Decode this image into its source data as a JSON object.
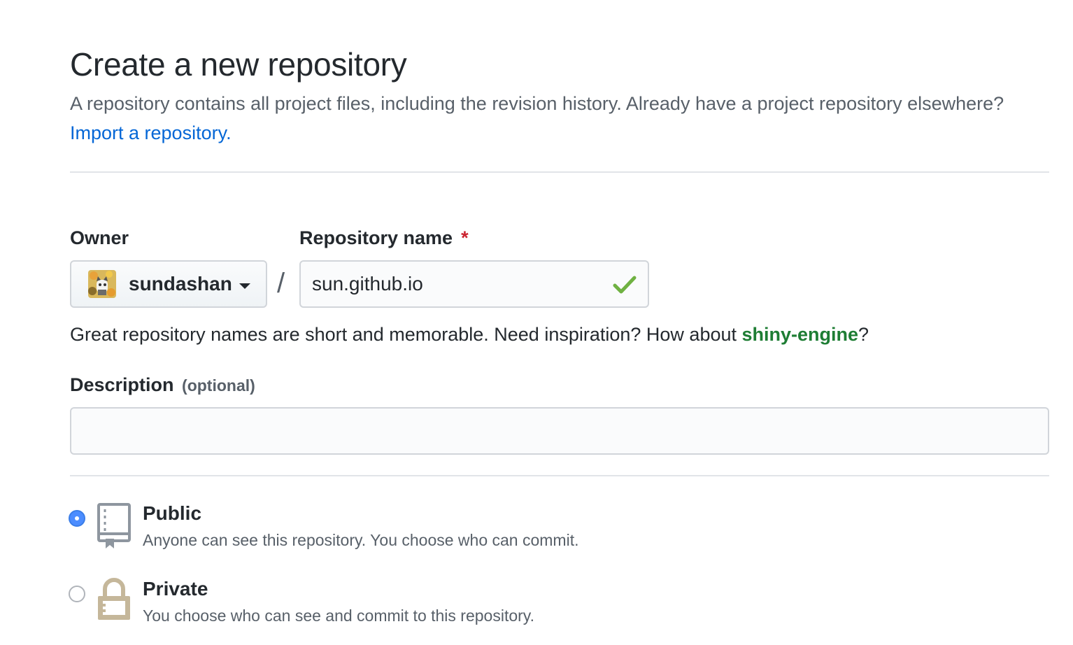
{
  "header": {
    "title": "Create a new repository",
    "subtitle_text": "A repository contains all project files, including the revision history. Already have a project repository elsewhere?",
    "import_link": "Import a repository."
  },
  "form": {
    "owner_label": "Owner",
    "owner_value": "sundashan",
    "repo_label": "Repository name",
    "required_mark": "*",
    "slash": "/",
    "repo_value": "sun.github.io",
    "hint_prefix": "Great repository names are short and memorable. Need inspiration? How about",
    "hint_suggestion": "shiny-engine",
    "hint_suffix": "?",
    "description_label": "Description",
    "description_optional": "(optional)",
    "description_value": ""
  },
  "visibility": {
    "public_title": "Public",
    "public_desc": "Anyone can see this repository. You choose who can commit.",
    "private_title": "Private",
    "private_desc": "You choose who can see and commit to this repository.",
    "selected": "Public"
  },
  "colors": {
    "link": "#0366d6",
    "suggestion": "#1e7e34",
    "required": "#cb2431",
    "valid_check": "#6fb142",
    "radio_selected": "#4c8dff",
    "lock_icon": "#c5b79a"
  },
  "icons": {
    "check": "check-icon",
    "caret": "caret-down-icon",
    "public": "repo-book-icon",
    "private": "lock-icon"
  }
}
